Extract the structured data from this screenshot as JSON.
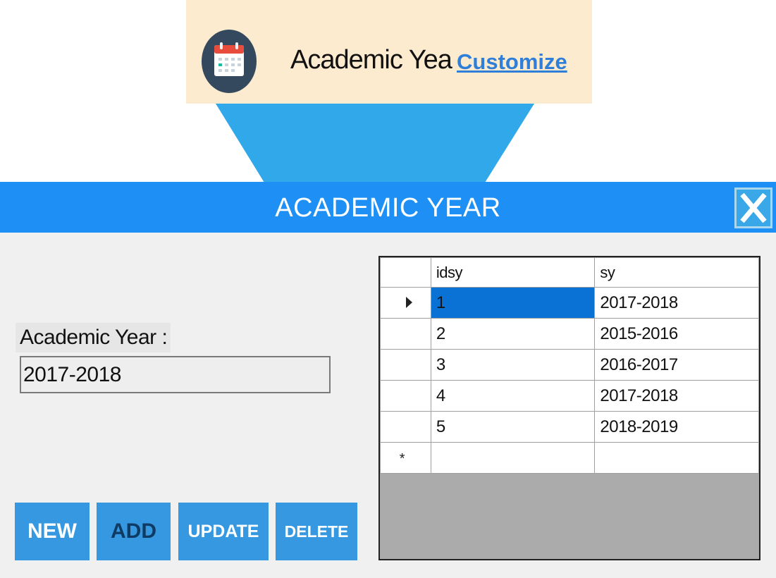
{
  "callout": {
    "label": "Academic Year",
    "link": "Customize"
  },
  "window": {
    "title": "ACADEMIC YEAR",
    "close_label": "X"
  },
  "form": {
    "label": "Academic Year :",
    "value": "2017-2018"
  },
  "buttons": {
    "new": "NEW",
    "add": "ADD",
    "update": "UPDATE",
    "delete": "DELETE"
  },
  "grid": {
    "columns": [
      "idsy",
      "sy"
    ],
    "rows": [
      {
        "idsy": "1",
        "sy": "2017-2018"
      },
      {
        "idsy": "2",
        "sy": "2015-2016"
      },
      {
        "idsy": "3",
        "sy": "2016-2017"
      },
      {
        "idsy": "4",
        "sy": "2017-2018"
      },
      {
        "idsy": "5",
        "sy": "2018-2019"
      }
    ],
    "selected_row": 0,
    "new_row_marker": "*"
  },
  "colors": {
    "title_bar": "#1e90f5",
    "button": "#3598e0",
    "callout_bg": "#fdebd0",
    "selection": "#0a72d4"
  },
  "icons": {
    "callout": "calendar-icon",
    "current_row": "row-pointer-icon",
    "close": "close-icon"
  }
}
